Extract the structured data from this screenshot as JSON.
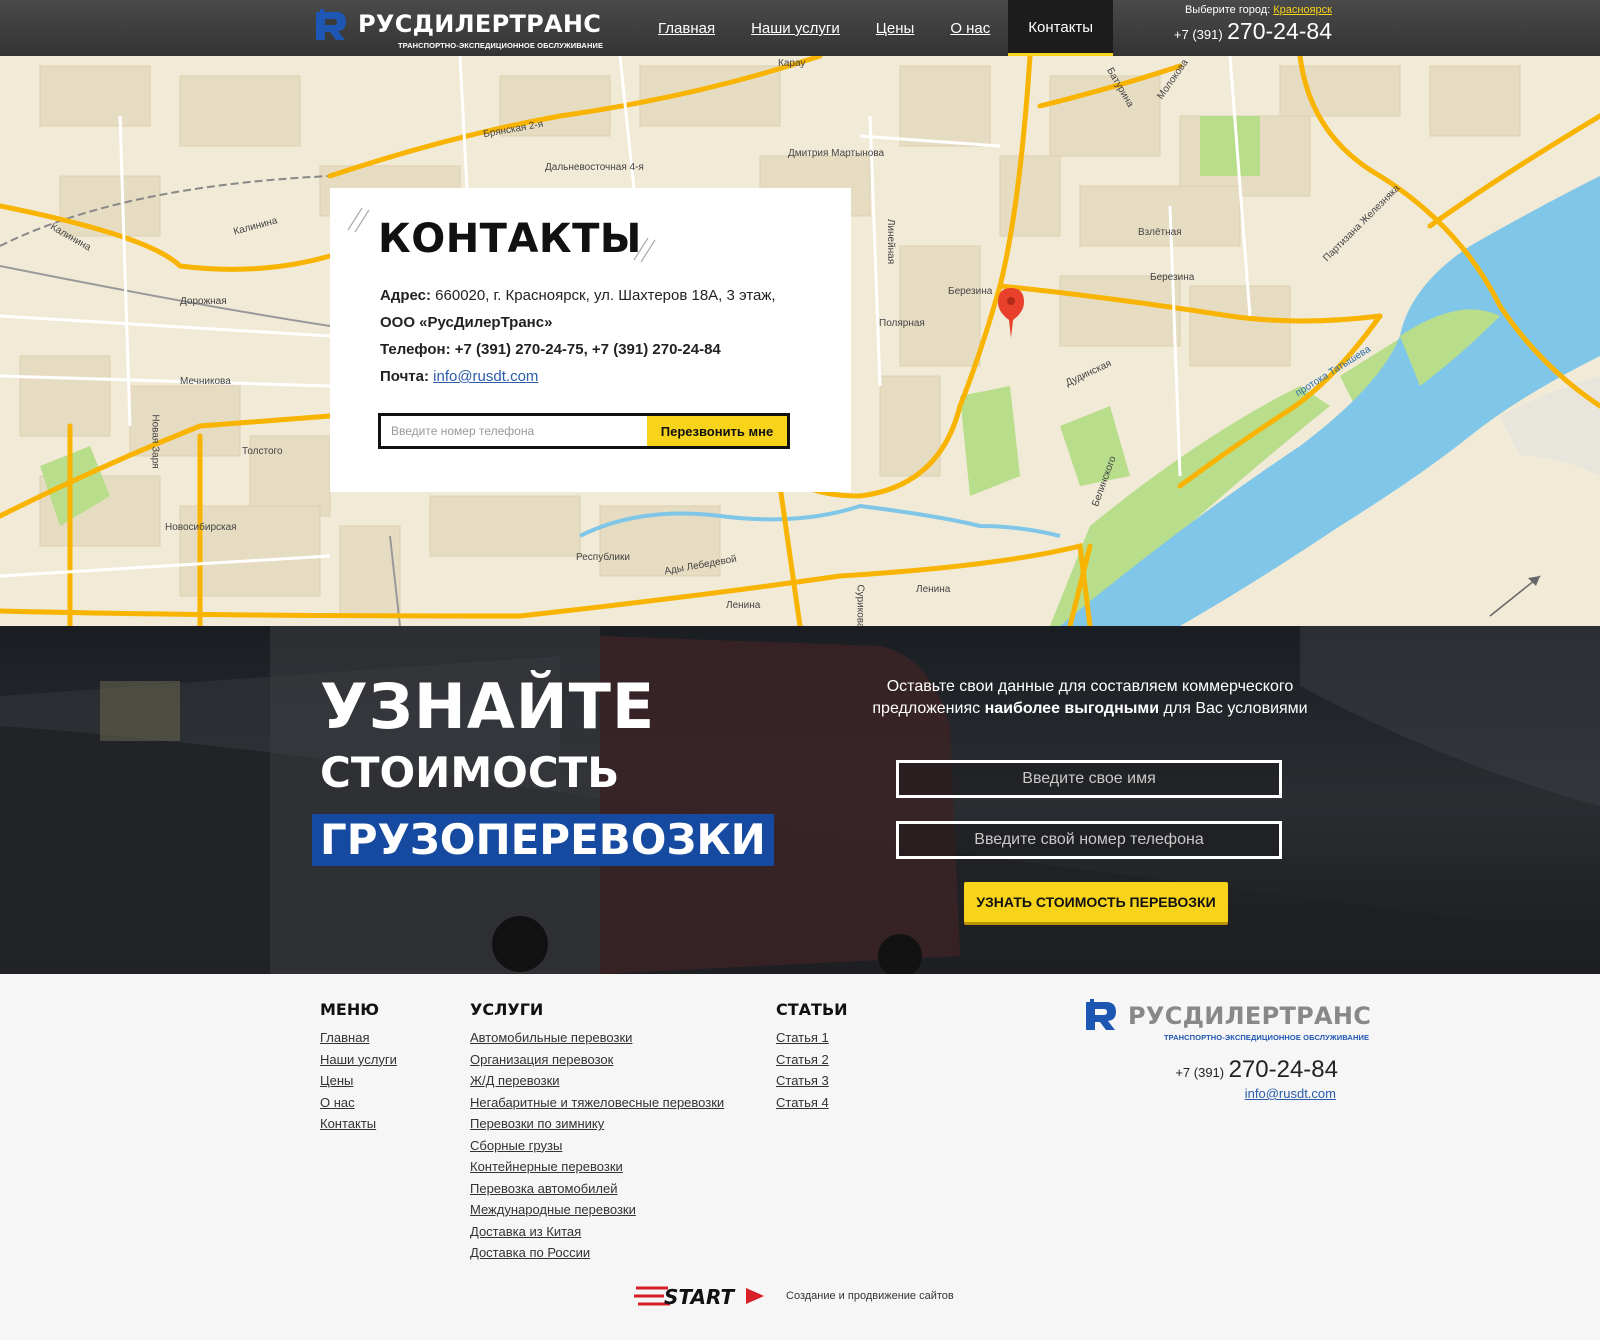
{
  "header": {
    "logo_title": "РУСДИЛЕРТРАНС",
    "logo_subtitle": "ТРАНСПОРТНО-ЭКСПЕДИЦИОННОЕ ОБСЛУЖИВАНИЕ",
    "nav": [
      "Главная",
      "Наши услуги",
      "Цены",
      "О нас",
      "Контакты"
    ],
    "active_nav": "Контакты",
    "city_prompt": "Выберите  город:",
    "city": "Красноярск",
    "phone_prefix": "+7 (391)",
    "phone": "270-24-84"
  },
  "map": {
    "streets": [
      "Карау",
      "Брянская 2-я",
      "Дальневосточная 4-я",
      "Дмитрия Мартынова",
      "Калинина",
      "Калинина",
      "Дорожная",
      "Мечникова",
      "Новая Заря",
      "Толстого",
      "Новосибирская",
      "Республики",
      "Ады Лебедевой",
      "Ленина",
      "Ленина",
      "Сурикова",
      "Линейная",
      "Полярная",
      "Березина",
      "Березина",
      "Взлётная",
      "Батурина",
      "Молокова",
      "Партизана Железняка",
      "Дудинская",
      "Белинского",
      "протока Татышева"
    ],
    "colors": {
      "land": "#f1ead7",
      "block": "#e6dcc2",
      "road": "#f8b400",
      "water": "#7fc6e8",
      "park": "#b8dd8b",
      "marker": "#e8402b"
    }
  },
  "contacts": {
    "title": "КОНТАКТЫ",
    "address_label": "Адрес:",
    "address": "660020, г. Красноярск, ул. Шахтеров 18А, 3 этаж,",
    "company": "ООО «РусДилерТранс»",
    "phone_label": "Телефон:",
    "phones": "+7 (391) 270-24-75,  +7 (391) 270-24-84",
    "email_label": "Почта:",
    "email": "info@rusdt.com",
    "callback_placeholder": "Введите номер телефона",
    "callback_button": "Перезвонить мне"
  },
  "cta": {
    "line1": "УЗНАЙТЕ",
    "line2": "СТОИМОСТЬ",
    "line3": "ГРУЗОПЕРЕВОЗКИ",
    "text_part1": "Оставьте свои данные для составляем коммерческого предложенияс ",
    "text_bold": "наиболее выгодными",
    "text_part2": " для Вас условиями",
    "name_placeholder": "Введите свое имя",
    "phone_placeholder": "Введите свой номер телефона",
    "button": "УЗНАТЬ СТОИМОСТЬ ПЕРЕВОЗКИ"
  },
  "footer": {
    "menu_title": "МЕНЮ",
    "menu": [
      "Главная",
      "Наши услуги",
      "Цены",
      "О нас",
      "Контакты"
    ],
    "services_title": "УСЛУГИ",
    "services": [
      "Автомобильные перевозки",
      "Организация перевозок",
      "Ж/Д перевозки",
      "Негабаритные и тяжеловесные перевозки",
      "Перевозки по зимнику",
      "Сборные грузы",
      "Контейнерные перевозки",
      "Перевозка автомобилей",
      "Международные перевозки",
      "Доставка из Китая",
      "Доставка по России"
    ],
    "articles_title": "СТАТЬИ",
    "articles": [
      "Статья 1",
      "Статья 2",
      "Статья 3",
      "Статья 4"
    ],
    "logo_title": "РУСДИЛЕРТРАНС",
    "logo_subtitle": "ТРАНСПОРТНО-ЭКСПЕДИЦИОННОЕ ОБСЛУЖИВАНИЕ",
    "phone_prefix": "+7 (391)",
    "phone": "270-24-84",
    "email": "info@rusdt.com",
    "dev_logo": "START",
    "dev_text": "Создание  и продвижение сайтов"
  },
  "colors": {
    "accent": "#f7d31a",
    "brand_blue": "#154aa0",
    "header_bg": "#3c3c3c"
  }
}
